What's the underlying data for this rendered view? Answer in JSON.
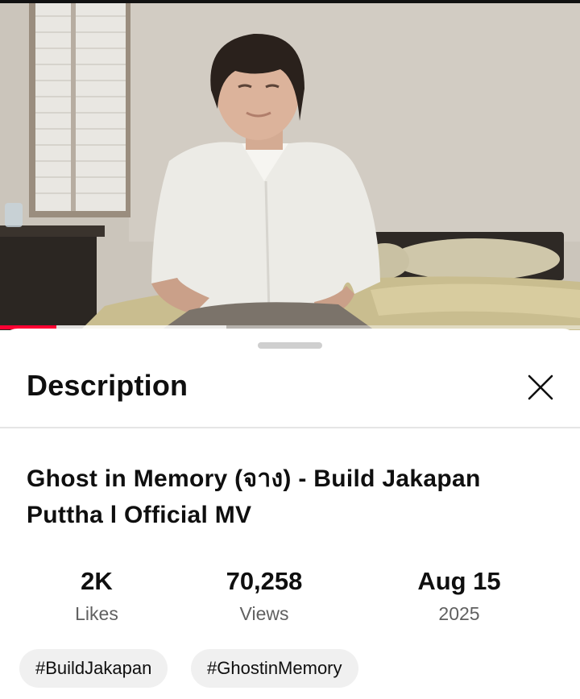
{
  "video": {
    "progress_fraction": 0.097,
    "buffered_fraction": 0.39,
    "progress_color": "#ff0033"
  },
  "description_sheet": {
    "title": "Description",
    "close_icon": "close-icon",
    "video_title": "Ghost in Memory (จาง) - Build Jakapan Puttha l Official MV",
    "stats": [
      {
        "value": "2K",
        "label": "Likes"
      },
      {
        "value": "70,258",
        "label": "Views"
      },
      {
        "value": "Aug 15",
        "label": "2025"
      }
    ],
    "tags": [
      "#BuildJakapan",
      "#GhostinMemory"
    ]
  }
}
